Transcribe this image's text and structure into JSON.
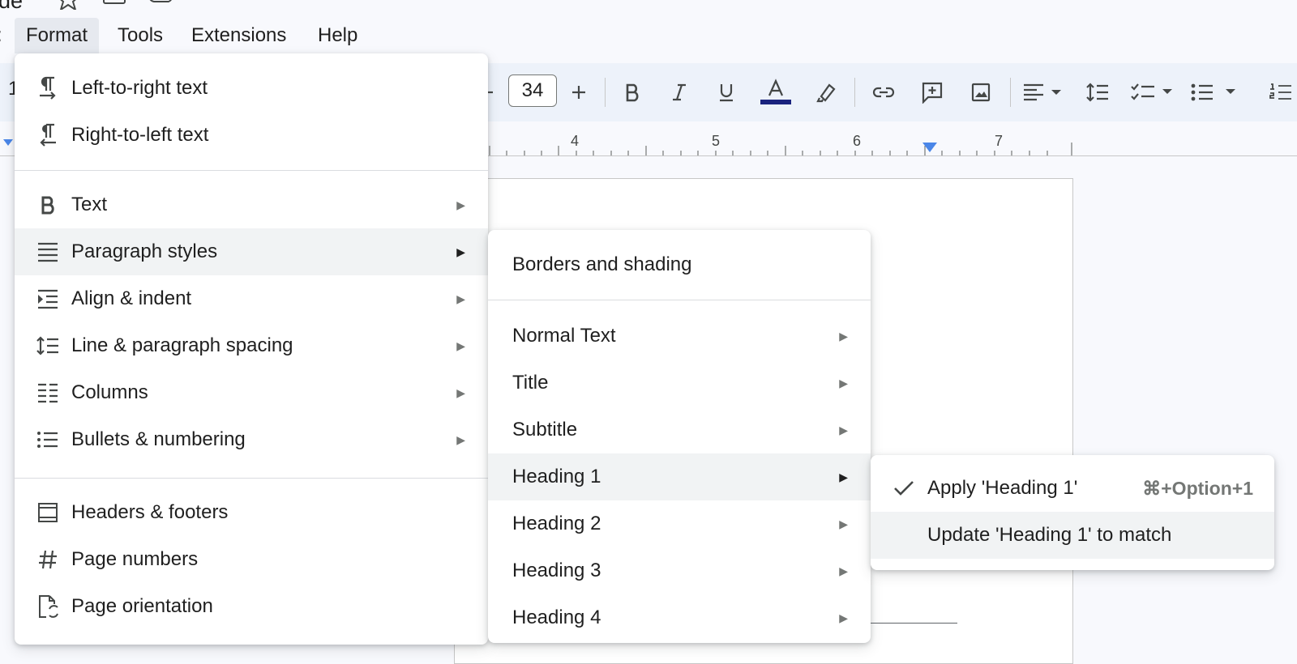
{
  "title": {
    "fragment": "de"
  },
  "menubar": {
    "items": [
      "Format",
      "Tools",
      "Extensions",
      "Help"
    ]
  },
  "toolbar": {
    "font_size": "34",
    "text_color": "#1a237e"
  },
  "ruler": {
    "numbers": [
      "4",
      "5",
      "6",
      "7"
    ]
  },
  "format_menu": {
    "items": [
      {
        "label": "Left-to-right text",
        "icon": "ltr-icon"
      },
      {
        "label": "Right-to-left text",
        "icon": "rtl-icon"
      },
      {
        "label": "Text",
        "icon": "bold-icon"
      },
      {
        "label": "Paragraph styles",
        "icon": "paragraph-styles-icon"
      },
      {
        "label": "Align & indent",
        "icon": "indent-icon"
      },
      {
        "label": "Line & paragraph spacing",
        "icon": "line-spacing-icon"
      },
      {
        "label": "Columns",
        "icon": "columns-icon"
      },
      {
        "label": "Bullets & numbering",
        "icon": "bullets-icon"
      },
      {
        "label": "Headers & footers",
        "icon": "headers-footers-icon"
      },
      {
        "label": "Page numbers",
        "icon": "hash-icon"
      },
      {
        "label": "Page orientation",
        "icon": "page-orientation-icon"
      }
    ]
  },
  "paragraph_styles_menu": {
    "items": [
      {
        "label": "Borders and shading"
      },
      {
        "label": "Normal Text"
      },
      {
        "label": "Title"
      },
      {
        "label": "Subtitle"
      },
      {
        "label": "Heading 1"
      },
      {
        "label": "Heading 2"
      },
      {
        "label": "Heading 3"
      },
      {
        "label": "Heading 4"
      }
    ]
  },
  "heading1_menu": {
    "apply_label": "Apply 'Heading 1'",
    "apply_shortcut": "⌘+Option+1",
    "update_label": "Update 'Heading 1' to match"
  },
  "colors": {
    "highlight": "#f1f3f4",
    "accent_blue": "#4a86e8"
  }
}
